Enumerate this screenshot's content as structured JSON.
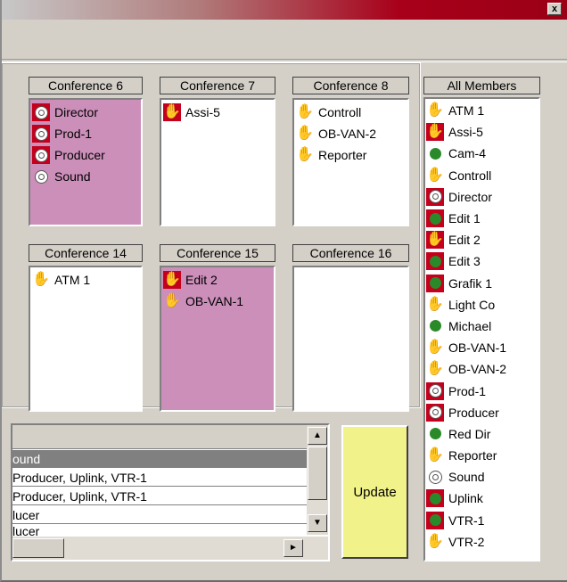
{
  "window": {
    "close_label": "x"
  },
  "conferences": [
    {
      "title": "Conference 6",
      "members": [
        {
          "name": "Director",
          "icon": "telephone-icon"
        },
        {
          "name": "Prod-1",
          "icon": "telephone-icon"
        },
        {
          "name": "Producer",
          "icon": "telephone-icon"
        },
        {
          "name": "Sound",
          "icon": "telephone-icon"
        }
      ]
    },
    {
      "title": "Conference 7",
      "members": [
        {
          "name": "Assi-5",
          "icon": "hand-icon"
        }
      ]
    },
    {
      "title": "Conference 8",
      "members": [
        {
          "name": "Controll",
          "icon": "hand-icon"
        },
        {
          "name": "OB-VAN-2",
          "icon": "hand-icon"
        },
        {
          "name": "Reporter",
          "icon": "hand-icon"
        }
      ]
    },
    {
      "title": "Conference 14",
      "members": [
        {
          "name": "ATM 1",
          "icon": "hand-icon"
        }
      ]
    },
    {
      "title": "Conference 15",
      "members": [
        {
          "name": "Edit 2",
          "icon": "hand-icon"
        },
        {
          "name": "OB-VAN-1",
          "icon": "hand-icon"
        }
      ]
    },
    {
      "title": "Conference 16",
      "members": []
    }
  ],
  "all_members": {
    "title": "All Members",
    "items": [
      {
        "name": "ATM 1",
        "icon": "hand-icon"
      },
      {
        "name": "Assi-5",
        "icon": "hand-icon"
      },
      {
        "name": "Cam-4",
        "icon": "green-dot-icon"
      },
      {
        "name": "Controll",
        "icon": "hand-icon"
      },
      {
        "name": "Director",
        "icon": "telephone-icon"
      },
      {
        "name": "Edit 1",
        "icon": "green-dot-icon"
      },
      {
        "name": "Edit 2",
        "icon": "hand-icon"
      },
      {
        "name": "Edit 3",
        "icon": "green-dot-icon"
      },
      {
        "name": "Grafik 1",
        "icon": "green-dot-icon"
      },
      {
        "name": "Light Co",
        "icon": "hand-icon"
      },
      {
        "name": "Michael",
        "icon": "green-dot-icon"
      },
      {
        "name": "OB-VAN-1",
        "icon": "hand-icon"
      },
      {
        "name": "OB-VAN-2",
        "icon": "hand-icon"
      },
      {
        "name": "Prod-1",
        "icon": "telephone-icon"
      },
      {
        "name": "Producer",
        "icon": "telephone-icon"
      },
      {
        "name": "Red Dir",
        "icon": "green-dot-icon"
      },
      {
        "name": "Reporter",
        "icon": "hand-icon"
      },
      {
        "name": "Sound",
        "icon": "telephone-icon"
      },
      {
        "name": "Uplink",
        "icon": "green-dot-icon"
      },
      {
        "name": "VTR-1",
        "icon": "green-dot-icon"
      },
      {
        "name": "VTR-2",
        "icon": "hand-icon"
      }
    ]
  },
  "grid": {
    "rows": [
      "ound",
      "Producer, Uplink, VTR-1",
      "Producer, Uplink, VTR-1",
      "lucer",
      "lucer"
    ]
  },
  "update_label": "Update",
  "colors": {
    "pink": "#cc8fba",
    "red": "#c4001c",
    "green": "#2a8a2a",
    "update_bg": "#f2f28a"
  }
}
